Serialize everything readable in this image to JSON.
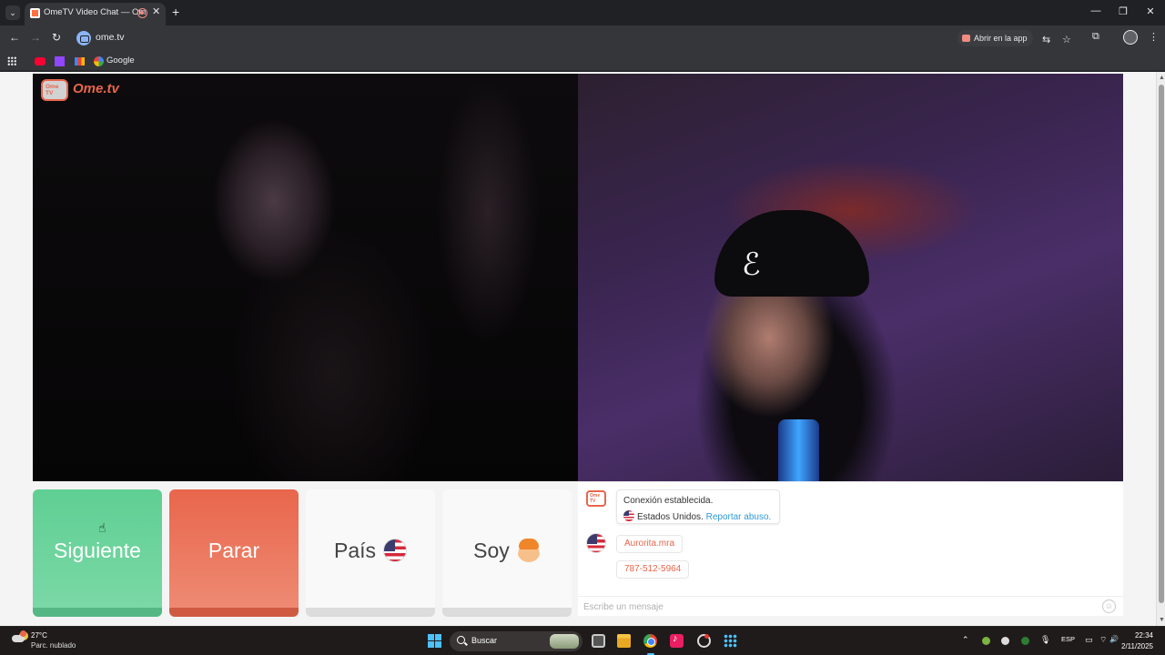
{
  "browser": {
    "tab_title": "OmeTV Video Chat — Ome",
    "new_tab_symbol": "+",
    "close_symbol": "✕",
    "url": "ome.tv",
    "open_in_app_label": "Abrir en la app",
    "bookmarks": {
      "google_label": "Google"
    },
    "window_controls": {
      "minimize": "—",
      "maximize": "❐",
      "close": "✕"
    }
  },
  "page": {
    "logo_icon_text": "Ome TV",
    "logo_text": "Ome.tv",
    "buttons": {
      "next_label": "Siguiente",
      "stop_label": "Parar",
      "country_label": "País",
      "gender_label": "Soy"
    },
    "chat": {
      "system_title": "Conexión establecida.",
      "system_country": "Estados Unidos.",
      "report_link": "Reportar abuso.",
      "messages": [
        {
          "text": "Aurorita.mra"
        },
        {
          "text": "787-512-5964"
        }
      ],
      "input_placeholder": "Escribe un mensaje",
      "emoji_symbol": "☺"
    }
  },
  "taskbar": {
    "temperature": "27°C",
    "condition": "Parc. nublado",
    "search_label": "Buscar",
    "language": "ESP",
    "time": "22:34",
    "date": "2/11/2025"
  },
  "colors": {
    "accent_orange": "#e8664c",
    "next_green": "#5fcf93",
    "link_blue": "#2f9bd8",
    "windows_blue": "#4cc2ff"
  }
}
